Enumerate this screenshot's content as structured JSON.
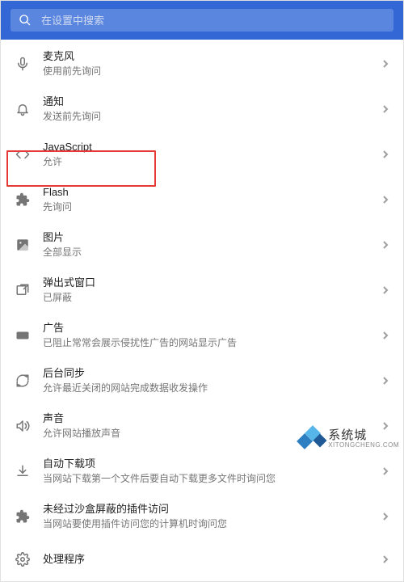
{
  "search": {
    "placeholder": "在设置中搜索"
  },
  "items": [
    {
      "id": "mic",
      "title": "麦克风",
      "subtitle": "使用前先询问",
      "icon": "mic"
    },
    {
      "id": "notify",
      "title": "通知",
      "subtitle": "发送前先询问",
      "icon": "bell"
    },
    {
      "id": "js",
      "title": "JavaScript",
      "subtitle": "允许",
      "icon": "code"
    },
    {
      "id": "flash",
      "title": "Flash",
      "subtitle": "先询问",
      "icon": "puzzle"
    },
    {
      "id": "images",
      "title": "图片",
      "subtitle": "全部显示",
      "icon": "image"
    },
    {
      "id": "popups",
      "title": "弹出式窗口",
      "subtitle": "已屏蔽",
      "icon": "popup"
    },
    {
      "id": "ads",
      "title": "广告",
      "subtitle": "已阻止常常会展示侵扰性广告的网站显示广告",
      "icon": "ad"
    },
    {
      "id": "bgsync",
      "title": "后台同步",
      "subtitle": "允许最近关闭的网站完成数据收发操作",
      "icon": "sync"
    },
    {
      "id": "sound",
      "title": "声音",
      "subtitle": "允许网站播放声音",
      "icon": "speaker"
    },
    {
      "id": "autodl",
      "title": "自动下载项",
      "subtitle": "当网站下载第一个文件后要自动下载更多文件时询问您",
      "icon": "download"
    },
    {
      "id": "unsandbox",
      "title": "未经过沙盒屏蔽的插件访问",
      "subtitle": "当网站要使用插件访问您的计算机时询问您",
      "icon": "puzzle"
    },
    {
      "id": "handlers",
      "title": "处理程序",
      "subtitle": "",
      "icon": "gear"
    }
  ],
  "watermark": {
    "cn": "系统城",
    "en": "XITONGCHENG.COM"
  }
}
